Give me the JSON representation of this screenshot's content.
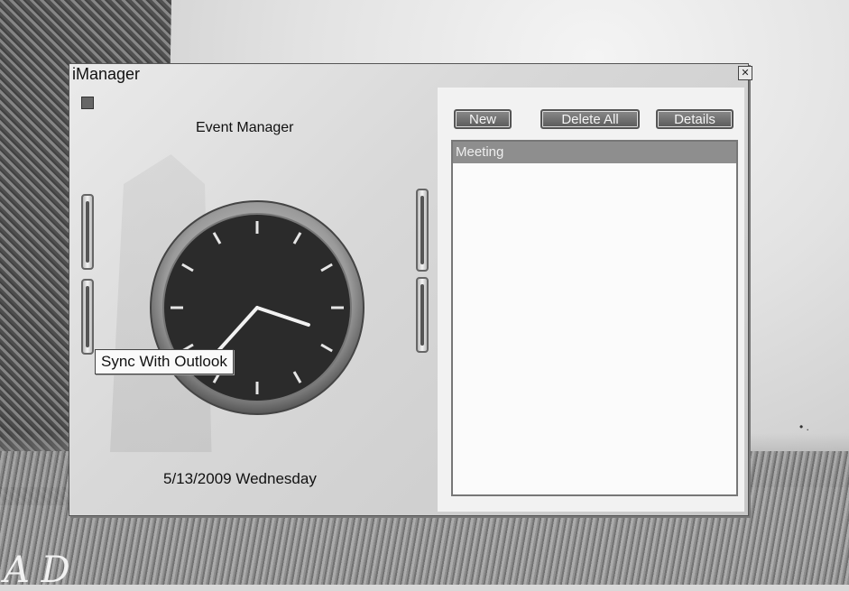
{
  "window": {
    "title": "iManager",
    "close_glyph": "✕",
    "heading": "Event Manager",
    "date_text": "5/13/2009 Wednesday",
    "tooltip": "Sync With Outlook"
  },
  "clock": {
    "hour": 3,
    "minute": 37,
    "face_color": "#2b2b2b",
    "tick_color": "#e6e6e6",
    "hand_color": "#f2f2f2"
  },
  "toolbar": {
    "new_label": "New",
    "delete_all_label": "Delete All",
    "details_label": "Details"
  },
  "events": [
    {
      "label": "Meeting",
      "selected": true
    }
  ],
  "desktop": {
    "corner_text": "A D"
  }
}
